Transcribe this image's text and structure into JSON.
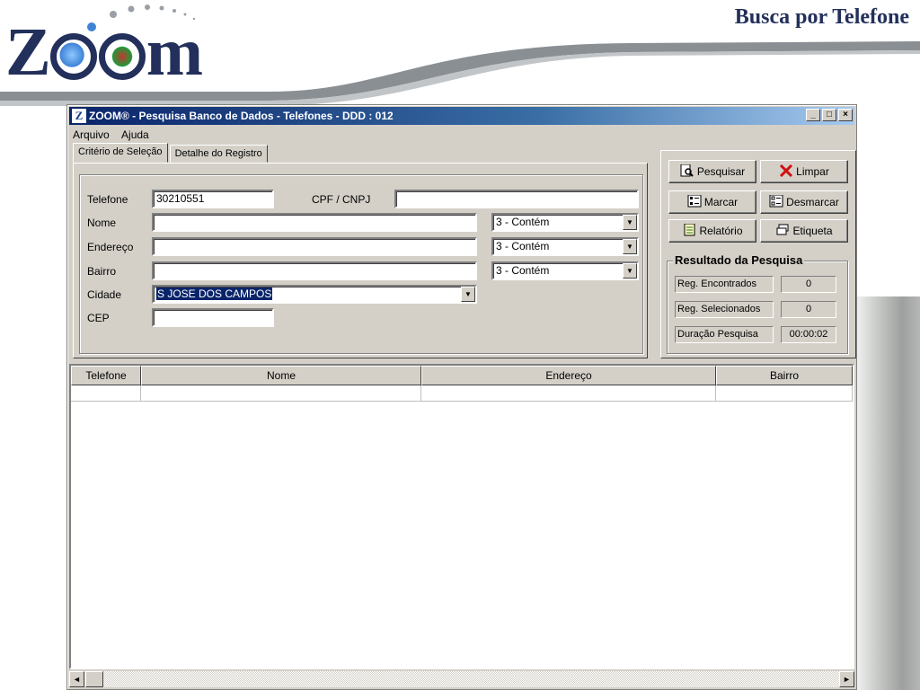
{
  "slide": {
    "title": "Busca por Telefone",
    "logo_text_z": "Z",
    "logo_text_m": "m"
  },
  "window": {
    "title": "ZOOM® - Pesquisa Banco de Dados - Telefones - DDD : 012",
    "app_icon": "Z",
    "controls": {
      "minimize": "_",
      "maximize": "□",
      "close": "×"
    }
  },
  "menu": {
    "file": "Arquivo",
    "help": "Ajuda"
  },
  "tabs": [
    {
      "label": "Critério de Seleção"
    },
    {
      "label": "Detalhe do Registro"
    }
  ],
  "form": {
    "telefone_label": "Telefone",
    "telefone_value": "30210551",
    "cpf_label": "CPF / CNPJ",
    "cpf_value": "",
    "nome_label": "Nome",
    "nome_value": "",
    "nome_filter": "3 - Contém",
    "endereco_label": "Endereço",
    "endereco_value": "",
    "endereco_filter": "3 - Contém",
    "bairro_label": "Bairro",
    "bairro_value": "",
    "bairro_filter": "3 - Contém",
    "cidade_label": "Cidade",
    "cidade_value": "S JOSE DOS CAMPOS",
    "cep_label": "CEP",
    "cep_value": ""
  },
  "actions": {
    "search": "Pesquisar",
    "clear": "Limpar",
    "mark": "Marcar",
    "unmark": "Desmarcar",
    "report": "Relatório",
    "label": "Etiqueta"
  },
  "results": {
    "title": "Resultado da Pesquisa",
    "found_label": "Reg. Encontrados",
    "found_value": "0",
    "selected_label": "Reg. Selecionados",
    "selected_value": "0",
    "duration_label": "Duração Pesquisa",
    "duration_value": "00:00:02"
  },
  "grid": {
    "columns": [
      "Telefone",
      "Nome",
      "Endereço",
      "Bairro"
    ]
  },
  "scrollbar": {
    "left": "◄",
    "right": "►"
  }
}
